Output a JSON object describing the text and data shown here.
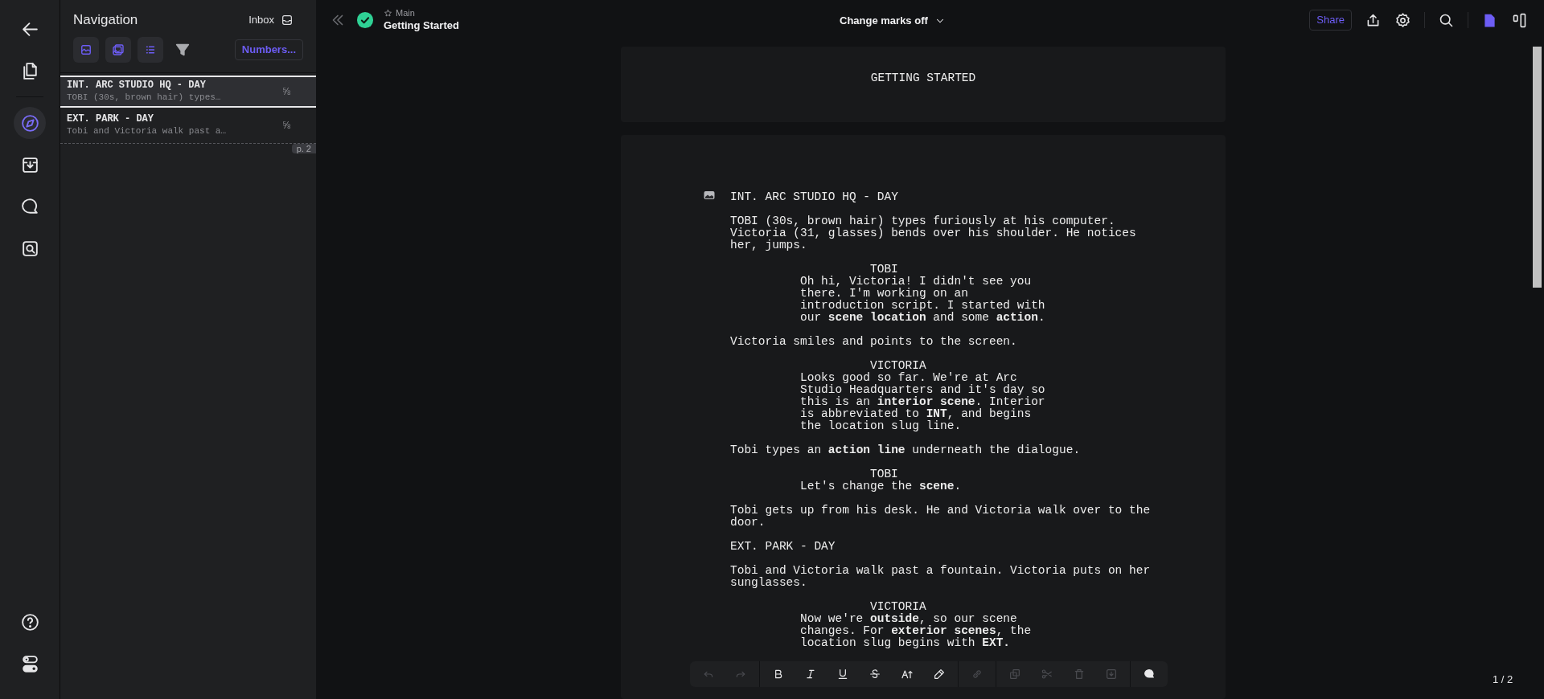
{
  "rail": {
    "top": [
      {
        "kind": "back",
        "selected": false
      },
      {
        "kind": "documents",
        "selected": false
      },
      {
        "kind": "navigation",
        "selected": true
      },
      {
        "kind": "export",
        "selected": false
      },
      {
        "kind": "comments",
        "selected": false
      },
      {
        "kind": "search",
        "selected": false
      }
    ],
    "bottom": [
      {
        "kind": "help",
        "selected": false
      },
      {
        "kind": "toggle",
        "selected": false
      }
    ]
  },
  "navigation": {
    "title": "Navigation",
    "inbox": "Inbox",
    "tools": [
      {
        "kind": "cards"
      },
      {
        "kind": "gallery"
      },
      {
        "kind": "outline"
      },
      {
        "kind": "filter"
      }
    ],
    "numbers_button": "Numbers...",
    "scenes": [
      {
        "heading": "INT. ARC STUDIO HQ - DAY",
        "summary": "TOBI (30s, brown hair) types…",
        "length": "⅝",
        "selected": true
      },
      {
        "heading": "EXT. PARK - DAY",
        "summary": "Tobi and Victoria walk past a…",
        "length": "⅝",
        "selected": false
      }
    ],
    "page_break": "p. 2"
  },
  "header": {
    "branch": "Main",
    "title": "Getting Started",
    "change_marks": "Change marks off",
    "share": "Share"
  },
  "title_page": {
    "title": "GETTING STARTED"
  },
  "script": [
    {
      "kind": "scene_heading",
      "text": "INT. ARC STUDIO HQ - DAY",
      "has_image": true
    },
    {
      "kind": "action",
      "text": "TOBI (30s, brown hair) types furiously at his computer. Victoria (31, glasses) bends over his shoulder. He notices her, jumps."
    },
    {
      "kind": "character",
      "text": "TOBI"
    },
    {
      "kind": "dialogue",
      "text": "Oh hi, Victoria! I didn't see you there. I'm working on an introduction script. I started with our **scene location** and some **action**."
    },
    {
      "kind": "action",
      "text": "Victoria smiles and points to the screen."
    },
    {
      "kind": "character",
      "text": "VICTORIA"
    },
    {
      "kind": "dialogue",
      "text": "Looks good so far. We're at Arc Studio Headquarters and it's day so this is an **interior scene**. Interior is abbreviated to **INT**, and begins the location slug line."
    },
    {
      "kind": "action",
      "text": "Tobi types an **action line** underneath the dialogue."
    },
    {
      "kind": "character",
      "text": "TOBI"
    },
    {
      "kind": "dialogue",
      "text": "Let's change the **scene**."
    },
    {
      "kind": "action",
      "text": "Tobi gets up from his desk. He and Victoria walk over to the door."
    },
    {
      "kind": "scene_heading",
      "text": "EXT. PARK - DAY",
      "has_image": false
    },
    {
      "kind": "action",
      "text": "Tobi and Victoria walk past a fountain. Victoria puts on her sunglasses."
    },
    {
      "kind": "character",
      "text": "VICTORIA"
    },
    {
      "kind": "dialogue",
      "text": "Now we're **outside**, so our scene changes. For **exterior scenes**, the location slug begins with **EXT.**"
    }
  ],
  "toolbar": [
    [
      {
        "kind": "undo",
        "disabled": true
      },
      {
        "kind": "redo",
        "disabled": true
      }
    ],
    [
      {
        "kind": "bold",
        "disabled": false
      },
      {
        "kind": "italic",
        "disabled": false
      },
      {
        "kind": "underline",
        "disabled": false
      },
      {
        "kind": "strike",
        "disabled": false
      },
      {
        "kind": "text_size",
        "disabled": false
      },
      {
        "kind": "highlight",
        "disabled": false
      }
    ],
    [
      {
        "kind": "link",
        "disabled": true
      }
    ],
    [
      {
        "kind": "copy",
        "disabled": true
      },
      {
        "kind": "cut",
        "disabled": true
      },
      {
        "kind": "delete",
        "disabled": true
      },
      {
        "kind": "insert",
        "disabled": true
      }
    ],
    [
      {
        "kind": "comment",
        "disabled": false
      }
    ]
  ],
  "page_indicator": "1 / 2"
}
